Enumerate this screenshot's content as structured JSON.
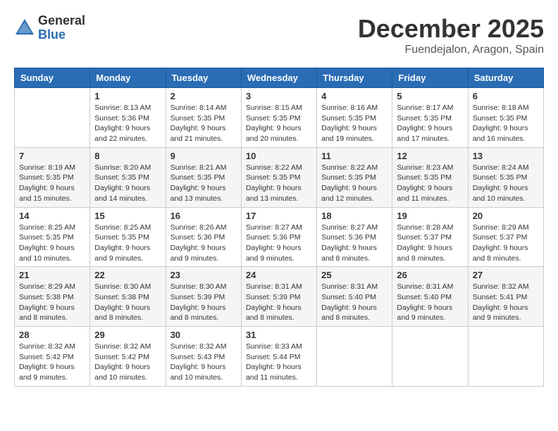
{
  "header": {
    "logo": {
      "general": "General",
      "blue": "Blue"
    },
    "title": "December 2025",
    "location": "Fuendejalon, Aragon, Spain"
  },
  "weekdays": [
    "Sunday",
    "Monday",
    "Tuesday",
    "Wednesday",
    "Thursday",
    "Friday",
    "Saturday"
  ],
  "weeks": [
    [
      {
        "day": "",
        "info": ""
      },
      {
        "day": "1",
        "info": "Sunrise: 8:13 AM\nSunset: 5:36 PM\nDaylight: 9 hours\nand 22 minutes."
      },
      {
        "day": "2",
        "info": "Sunrise: 8:14 AM\nSunset: 5:35 PM\nDaylight: 9 hours\nand 21 minutes."
      },
      {
        "day": "3",
        "info": "Sunrise: 8:15 AM\nSunset: 5:35 PM\nDaylight: 9 hours\nand 20 minutes."
      },
      {
        "day": "4",
        "info": "Sunrise: 8:16 AM\nSunset: 5:35 PM\nDaylight: 9 hours\nand 19 minutes."
      },
      {
        "day": "5",
        "info": "Sunrise: 8:17 AM\nSunset: 5:35 PM\nDaylight: 9 hours\nand 17 minutes."
      },
      {
        "day": "6",
        "info": "Sunrise: 8:18 AM\nSunset: 5:35 PM\nDaylight: 9 hours\nand 16 minutes."
      }
    ],
    [
      {
        "day": "7",
        "info": "Sunrise: 8:19 AM\nSunset: 5:35 PM\nDaylight: 9 hours\nand 15 minutes."
      },
      {
        "day": "8",
        "info": "Sunrise: 8:20 AM\nSunset: 5:35 PM\nDaylight: 9 hours\nand 14 minutes."
      },
      {
        "day": "9",
        "info": "Sunrise: 8:21 AM\nSunset: 5:35 PM\nDaylight: 9 hours\nand 13 minutes."
      },
      {
        "day": "10",
        "info": "Sunrise: 8:22 AM\nSunset: 5:35 PM\nDaylight: 9 hours\nand 13 minutes."
      },
      {
        "day": "11",
        "info": "Sunrise: 8:22 AM\nSunset: 5:35 PM\nDaylight: 9 hours\nand 12 minutes."
      },
      {
        "day": "12",
        "info": "Sunrise: 8:23 AM\nSunset: 5:35 PM\nDaylight: 9 hours\nand 11 minutes."
      },
      {
        "day": "13",
        "info": "Sunrise: 8:24 AM\nSunset: 5:35 PM\nDaylight: 9 hours\nand 10 minutes."
      }
    ],
    [
      {
        "day": "14",
        "info": "Sunrise: 8:25 AM\nSunset: 5:35 PM\nDaylight: 9 hours\nand 10 minutes."
      },
      {
        "day": "15",
        "info": "Sunrise: 8:25 AM\nSunset: 5:35 PM\nDaylight: 9 hours\nand 9 minutes."
      },
      {
        "day": "16",
        "info": "Sunrise: 8:26 AM\nSunset: 5:36 PM\nDaylight: 9 hours\nand 9 minutes."
      },
      {
        "day": "17",
        "info": "Sunrise: 8:27 AM\nSunset: 5:36 PM\nDaylight: 9 hours\nand 9 minutes."
      },
      {
        "day": "18",
        "info": "Sunrise: 8:27 AM\nSunset: 5:36 PM\nDaylight: 9 hours\nand 8 minutes."
      },
      {
        "day": "19",
        "info": "Sunrise: 8:28 AM\nSunset: 5:37 PM\nDaylight: 9 hours\nand 8 minutes."
      },
      {
        "day": "20",
        "info": "Sunrise: 8:29 AM\nSunset: 5:37 PM\nDaylight: 9 hours\nand 8 minutes."
      }
    ],
    [
      {
        "day": "21",
        "info": "Sunrise: 8:29 AM\nSunset: 5:38 PM\nDaylight: 9 hours\nand 8 minutes."
      },
      {
        "day": "22",
        "info": "Sunrise: 8:30 AM\nSunset: 5:38 PM\nDaylight: 9 hours\nand 8 minutes."
      },
      {
        "day": "23",
        "info": "Sunrise: 8:30 AM\nSunset: 5:39 PM\nDaylight: 9 hours\nand 8 minutes."
      },
      {
        "day": "24",
        "info": "Sunrise: 8:31 AM\nSunset: 5:39 PM\nDaylight: 9 hours\nand 8 minutes."
      },
      {
        "day": "25",
        "info": "Sunrise: 8:31 AM\nSunset: 5:40 PM\nDaylight: 9 hours\nand 8 minutes."
      },
      {
        "day": "26",
        "info": "Sunrise: 8:31 AM\nSunset: 5:40 PM\nDaylight: 9 hours\nand 9 minutes."
      },
      {
        "day": "27",
        "info": "Sunrise: 8:32 AM\nSunset: 5:41 PM\nDaylight: 9 hours\nand 9 minutes."
      }
    ],
    [
      {
        "day": "28",
        "info": "Sunrise: 8:32 AM\nSunset: 5:42 PM\nDaylight: 9 hours\nand 9 minutes."
      },
      {
        "day": "29",
        "info": "Sunrise: 8:32 AM\nSunset: 5:42 PM\nDaylight: 9 hours\nand 10 minutes."
      },
      {
        "day": "30",
        "info": "Sunrise: 8:32 AM\nSunset: 5:43 PM\nDaylight: 9 hours\nand 10 minutes."
      },
      {
        "day": "31",
        "info": "Sunrise: 8:33 AM\nSunset: 5:44 PM\nDaylight: 9 hours\nand 11 minutes."
      },
      {
        "day": "",
        "info": ""
      },
      {
        "day": "",
        "info": ""
      },
      {
        "day": "",
        "info": ""
      }
    ]
  ]
}
